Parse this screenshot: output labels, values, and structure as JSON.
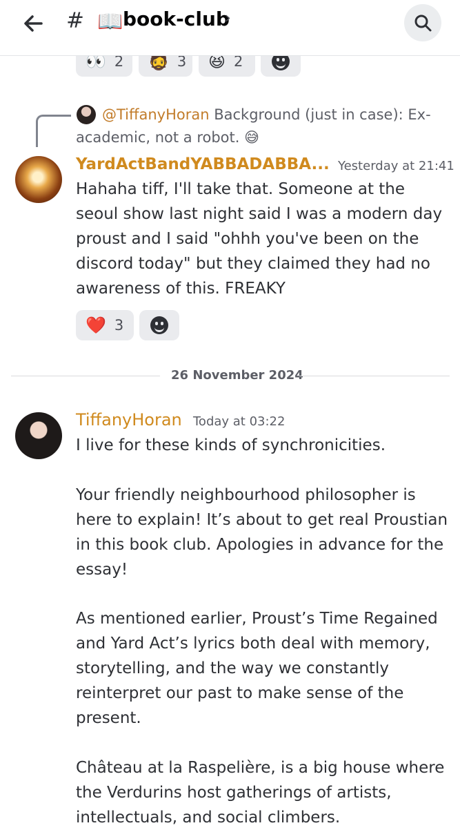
{
  "header": {
    "hash_symbol": "#",
    "channel_emoji": "📖",
    "channel_name": "book-club",
    "chevron": "›",
    "icons": {
      "back": "back-arrow-icon",
      "search": "search-icon"
    }
  },
  "top_reactions": [
    {
      "emoji": "👀",
      "count": "2"
    },
    {
      "emoji": "🧔",
      "count": "3"
    },
    {
      "emoji": "😆",
      "count": "2"
    }
  ],
  "reply": {
    "mention": "@TiffanyHoran",
    "text": " Background (just in case): Ex-academic, not a robot. 😅"
  },
  "message1": {
    "username": "YardActBandYABBADABBA...",
    "timestamp": "Yesterday at 21:41",
    "text": "Hahaha tiff, I'll take that. Someone at the seoul show last night said I was a modern day proust and I said \"ohhh you've been on the discord today\" but they claimed they had no awareness of this. FREAKY",
    "reactions": [
      {
        "emoji": "❤️",
        "count": "3"
      }
    ]
  },
  "date_divider": "26 November 2024",
  "message2": {
    "username": "TiffanyHoran",
    "timestamp": "Today at 03:22",
    "paragraphs": [
      "I live for these kinds of synchronicities.",
      "Your friendly neighbourhood philosopher is here to explain! It’s about to get real Proustian in this book club. Apologies in advance for the essay!",
      "As mentioned earlier, Proust’s Time Regained and Yard Act’s lyrics both deal with memory, storytelling, and the way we constantly reinterpret our past to make sense of the present.",
      "Château at la Raspelière, is a big house where the Verdurins host gatherings of artists, intellectuals, and social climbers."
    ]
  },
  "colors": {
    "username": "#d08a1e",
    "text": "#2e3035",
    "muted": "#5c5e66",
    "reaction_bg": "#eaebee"
  }
}
